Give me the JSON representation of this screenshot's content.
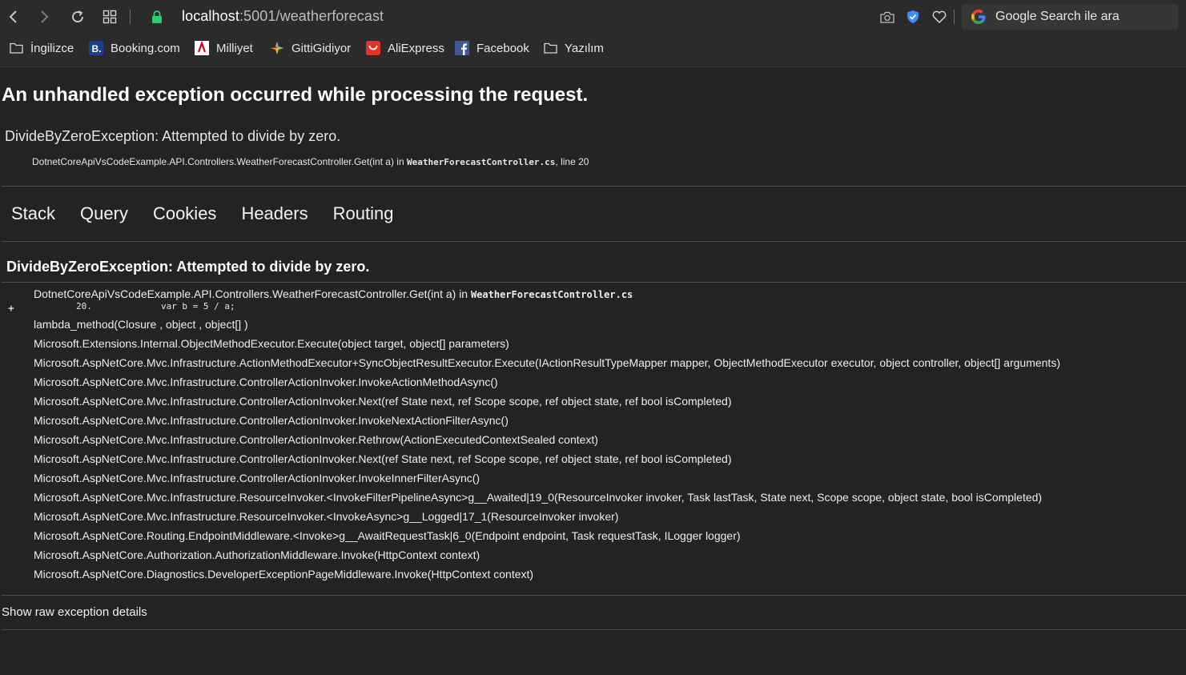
{
  "browser": {
    "url_host": "localhost",
    "url_rest": ":5001/weatherforecast",
    "search_placeholder": "Google Search ile ara",
    "bookmarks": [
      {
        "label": "İngilizce",
        "icon": "folder-icon"
      },
      {
        "label": "Booking.com",
        "icon": "booking-icon"
      },
      {
        "label": "Milliyet",
        "icon": "milliyet-icon"
      },
      {
        "label": "GittiGidiyor",
        "icon": "gittigidiyor-icon"
      },
      {
        "label": "AliExpress",
        "icon": "aliexpress-icon"
      },
      {
        "label": "Facebook",
        "icon": "facebook-icon"
      },
      {
        "label": "Yazılım",
        "icon": "folder-icon"
      }
    ]
  },
  "page": {
    "title": "An unhandled exception occurred while processing the request.",
    "message": "DivideByZeroException: Attempted to divide by zero.",
    "location_method": "DotnetCoreApiVsCodeExample.API.Controllers.WeatherForecastController.Get(int a) in ",
    "location_file": "WeatherForecastController.cs",
    "location_line": ", line 20",
    "tabs": [
      "Stack",
      "Query",
      "Cookies",
      "Headers",
      "Routing"
    ],
    "exception_heading": "DivideByZeroException: Attempted to divide by zero.",
    "expander": "+",
    "first_frame_method": "DotnetCoreApiVsCodeExample.API.Controllers.WeatherForecastController.Get(int a) in ",
    "first_frame_file": "WeatherForecastController.cs",
    "source_line": "        20.             var b = 5 / a;",
    "frames": [
      "lambda_method(Closure , object , object[] )",
      "Microsoft.Extensions.Internal.ObjectMethodExecutor.Execute(object target, object[] parameters)",
      "Microsoft.AspNetCore.Mvc.Infrastructure.ActionMethodExecutor+SyncObjectResultExecutor.Execute(IActionResultTypeMapper mapper, ObjectMethodExecutor executor, object controller, object[] arguments)",
      "Microsoft.AspNetCore.Mvc.Infrastructure.ControllerActionInvoker.InvokeActionMethodAsync()",
      "Microsoft.AspNetCore.Mvc.Infrastructure.ControllerActionInvoker.Next(ref State next, ref Scope scope, ref object state, ref bool isCompleted)",
      "Microsoft.AspNetCore.Mvc.Infrastructure.ControllerActionInvoker.InvokeNextActionFilterAsync()",
      "Microsoft.AspNetCore.Mvc.Infrastructure.ControllerActionInvoker.Rethrow(ActionExecutedContextSealed context)",
      "Microsoft.AspNetCore.Mvc.Infrastructure.ControllerActionInvoker.Next(ref State next, ref Scope scope, ref object state, ref bool isCompleted)",
      "Microsoft.AspNetCore.Mvc.Infrastructure.ControllerActionInvoker.InvokeInnerFilterAsync()",
      "Microsoft.AspNetCore.Mvc.Infrastructure.ResourceInvoker.<InvokeFilterPipelineAsync>g__Awaited|19_0(ResourceInvoker invoker, Task lastTask, State next, Scope scope, object state, bool isCompleted)",
      "Microsoft.AspNetCore.Mvc.Infrastructure.ResourceInvoker.<InvokeAsync>g__Logged|17_1(ResourceInvoker invoker)",
      "Microsoft.AspNetCore.Routing.EndpointMiddleware.<Invoke>g__AwaitRequestTask|6_0(Endpoint endpoint, Task requestTask, ILogger logger)",
      "Microsoft.AspNetCore.Authorization.AuthorizationMiddleware.Invoke(HttpContext context)",
      "Microsoft.AspNetCore.Diagnostics.DeveloperExceptionPageMiddleware.Invoke(HttpContext context)"
    ],
    "raw_link": "Show raw exception details"
  }
}
